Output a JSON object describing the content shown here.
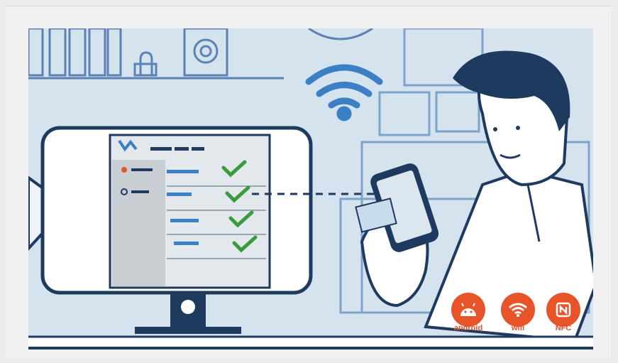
{
  "badges": [
    {
      "label": "android",
      "icon": "android-icon",
      "color": "#e8542a"
    },
    {
      "label": "wifi",
      "icon": "wifi-icon",
      "color": "#e8542a"
    },
    {
      "label": "NFC",
      "icon": "nfc-icon",
      "color": "#e8542a"
    }
  ],
  "colors": {
    "background": "#d4e3ee",
    "line": "#1f3a5f",
    "accent_blue": "#3b7fc4",
    "check_green": "#3a9a3e",
    "badge_orange": "#e8542a"
  }
}
